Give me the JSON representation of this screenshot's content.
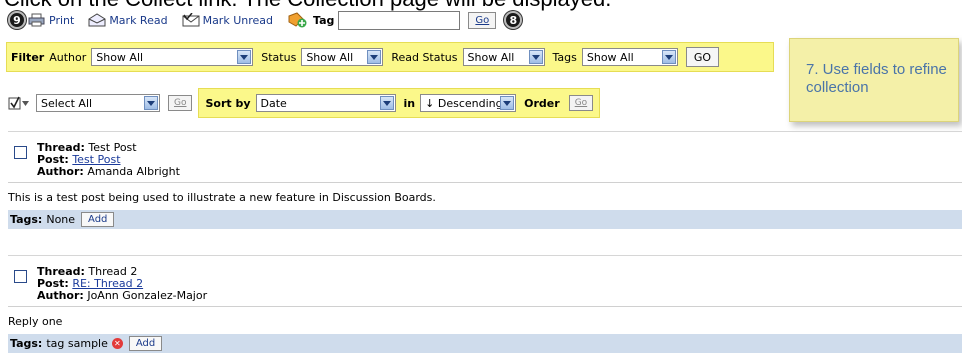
{
  "caption": "Click on the Collect link. The Collection page will be displayed.",
  "toolbar": {
    "badge_left": "9",
    "badge_right": "8",
    "print_label": "Print",
    "mark_read_label": "Mark Read",
    "mark_unread_label": "Mark Unread",
    "tag_label": "Tag",
    "tag_value": "",
    "go_label": "Go"
  },
  "filter": {
    "filter_label": "Filter",
    "author_label": "Author",
    "author_value": "Show All",
    "status_label": "Status",
    "status_value": "Show All",
    "read_status_label": "Read Status",
    "read_status_value": "Show All",
    "tags_label": "Tags",
    "tags_value": "Show All",
    "go_label": "GO"
  },
  "callout": {
    "text": "7. Use fields to refine collection"
  },
  "sort": {
    "select_all_value": "Select All",
    "go_label": "Go",
    "sort_by_label": "Sort by",
    "sort_by_value": "Date",
    "in_label": "in",
    "order_value": "↓ Descending",
    "order_label": "Order",
    "order_go_label": "Go"
  },
  "posts": [
    {
      "thread_label": "Thread:",
      "thread": "Test Post",
      "post_label": "Post:",
      "post": "Test Post",
      "author_label": "Author:",
      "author": "Amanda Albright",
      "body": "This is a test post being used to illustrate a new feature in Discussion Boards.",
      "tags_label": "Tags:",
      "tags": "None",
      "add_label": "Add"
    },
    {
      "thread_label": "Thread:",
      "thread": "Thread 2",
      "post_label": "Post:",
      "post": "RE: Thread 2",
      "author_label": "Author:",
      "author": "JoAnn Gonzalez-Major",
      "body": "Reply one",
      "tags_label": "Tags:",
      "tags": "tag sample",
      "add_label": "Add"
    }
  ],
  "colors": {
    "highlight": "#fbf88a",
    "tags_bar": "#cfdcec",
    "callout_text": "#4a74a8"
  }
}
